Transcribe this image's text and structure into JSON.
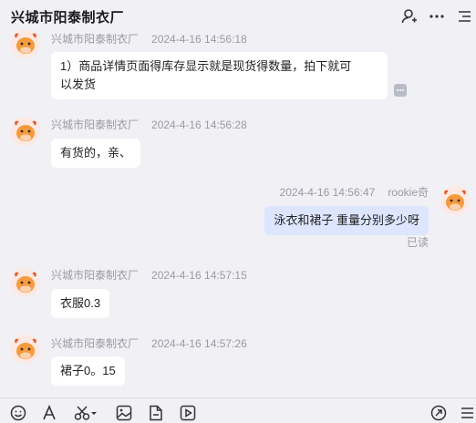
{
  "header": {
    "title": "兴城市阳泰制衣厂",
    "icons": [
      "user-icon",
      "more-icon",
      "menu-icon"
    ]
  },
  "messages": [
    {
      "sender": "兴城市阳泰制衣厂",
      "time": "2024-4-16 14:56:18",
      "lines": [
        "1）商品详情页面得库存显示就是现货得数量，拍下就可",
        "以发货"
      ],
      "self": false
    },
    {
      "sender": "兴城市阳泰制衣厂",
      "time": "2024-4-16 14:56:28",
      "lines": [
        "有货的，亲、"
      ],
      "self": false
    },
    {
      "sender": "rookie奇",
      "time": "2024-4-16 14:56:47",
      "lines": [
        "泳衣和裙子 重量分别多少呀"
      ],
      "self": true,
      "status": "已读"
    },
    {
      "sender": "兴城市阳泰制衣厂",
      "time": "2024-4-16 14:57:15",
      "lines": [
        "衣服0.3"
      ],
      "self": false
    },
    {
      "sender": "兴城市阳泰制衣厂",
      "time": "2024-4-16 14:57:26",
      "lines": [
        "裙子0。15"
      ],
      "self": false
    }
  ],
  "toolbar": {
    "icons": [
      "emoji-icon",
      "font-icon",
      "scissors-icon",
      "image-icon",
      "file-icon",
      "video-icon",
      "share-icon",
      "menu-icon"
    ]
  },
  "colors": {
    "background": "#f0f0f5",
    "self_bubble": "#dde6ff",
    "other_bubble": "#ffffff",
    "meta_text": "#9a9aa3"
  }
}
